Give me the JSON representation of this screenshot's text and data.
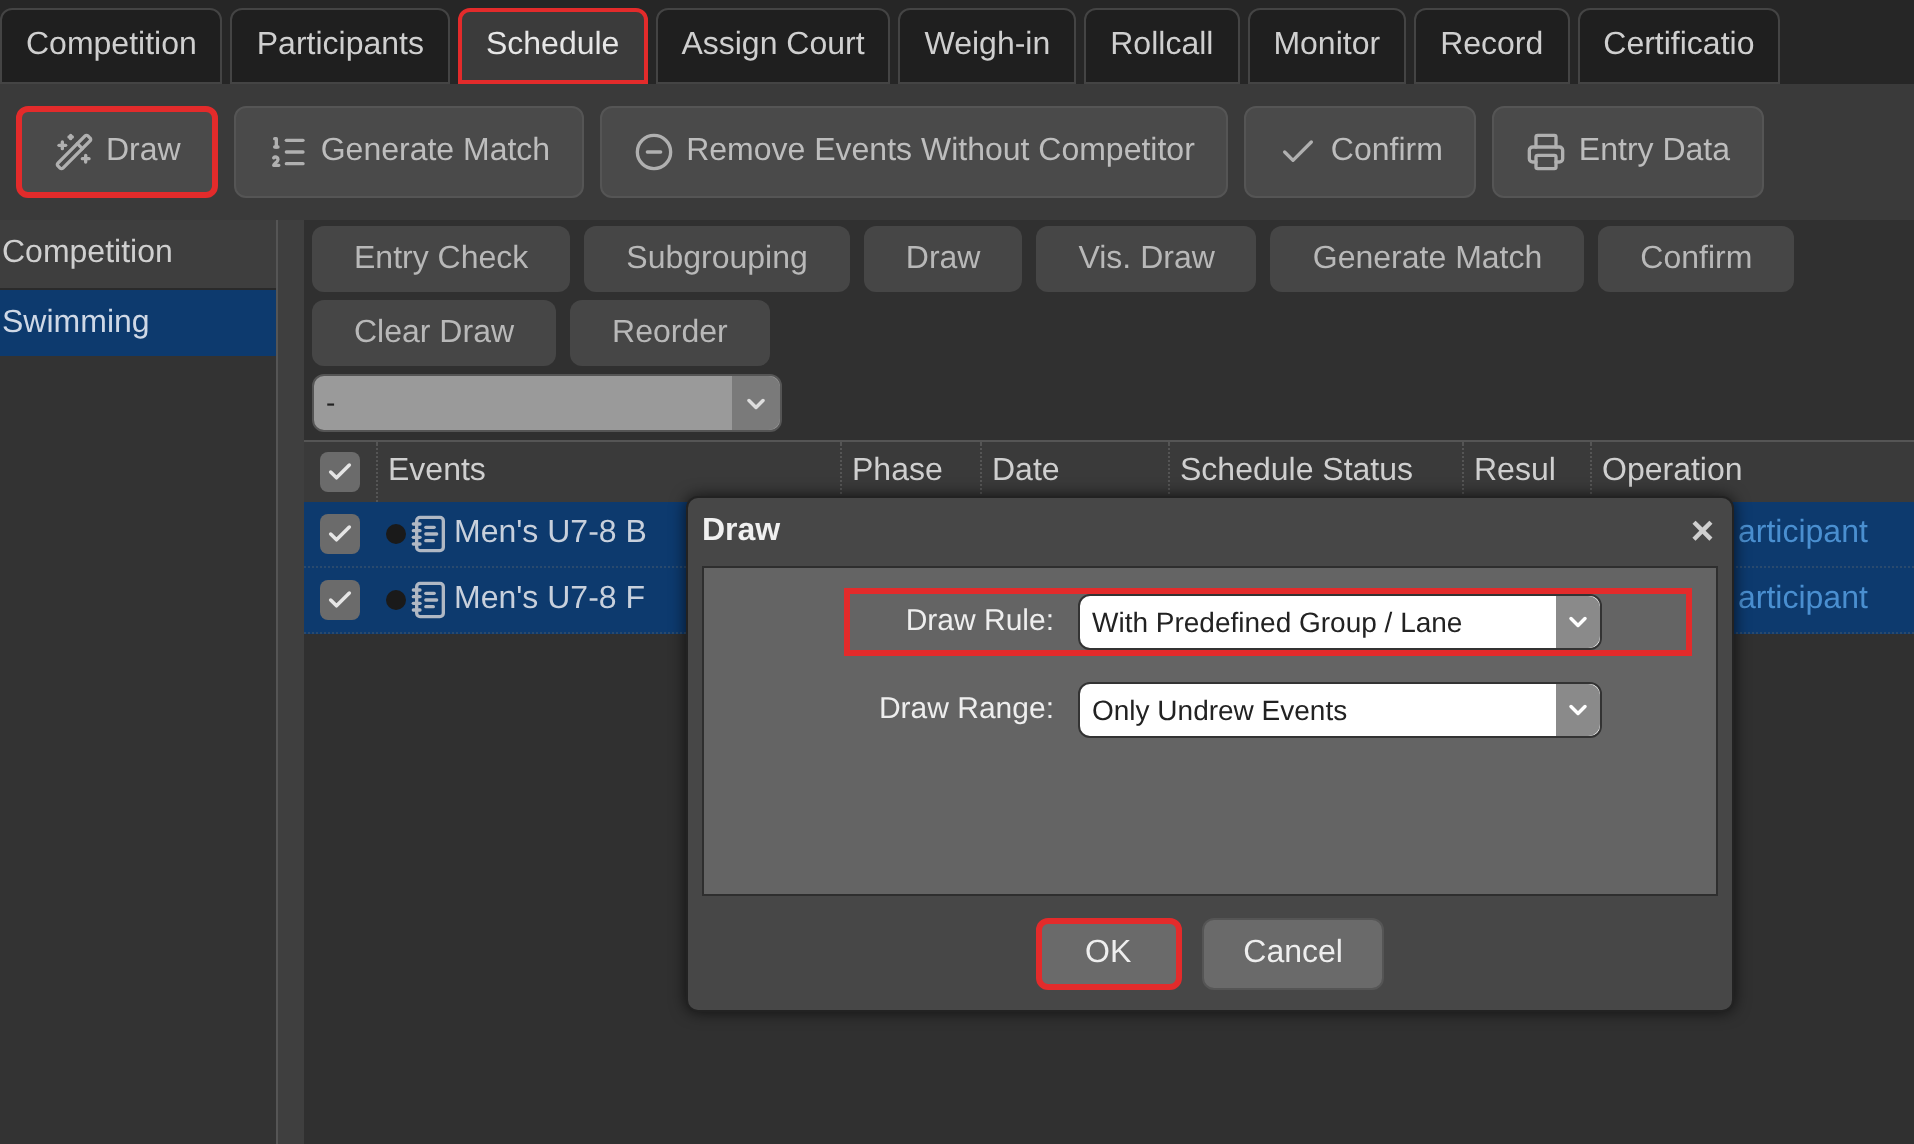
{
  "tabs": [
    {
      "label": "Competition",
      "selected": false
    },
    {
      "label": "Participants",
      "selected": false
    },
    {
      "label": "Schedule",
      "selected": true
    },
    {
      "label": "Assign Court",
      "selected": false
    },
    {
      "label": "Weigh-in",
      "selected": false
    },
    {
      "label": "Rollcall",
      "selected": false
    },
    {
      "label": "Monitor",
      "selected": false
    },
    {
      "label": "Record",
      "selected": false
    },
    {
      "label": "Certificatio",
      "selected": false
    }
  ],
  "toolbar": [
    {
      "label": "Draw",
      "highlighted": true
    },
    {
      "label": "Generate Match",
      "highlighted": false
    },
    {
      "label": "Remove Events Without Competitor",
      "highlighted": false
    },
    {
      "label": "Confirm",
      "highlighted": false
    },
    {
      "label": "Entry Data",
      "highlighted": false
    }
  ],
  "sidebar": {
    "header": "Competition",
    "items": [
      {
        "label": "Swimming",
        "selected": true
      }
    ]
  },
  "actions": [
    "Entry Check",
    "Subgrouping",
    "Draw",
    "Vis. Draw",
    "Generate Match",
    "Confirm",
    "Clear Draw",
    "Reorder"
  ],
  "filter": {
    "value": "-"
  },
  "table": {
    "all_checked": true,
    "columns": [
      "Events",
      "Phase",
      "Date",
      "Schedule Status",
      "Resul",
      "Operation"
    ],
    "rows": [
      {
        "checked": true,
        "selected": true,
        "event": "Men's U7-8 B",
        "operation": "articipant"
      },
      {
        "checked": true,
        "selected": true,
        "event": "Men's U7-8 F",
        "operation": "articipant"
      }
    ]
  },
  "dialog": {
    "title": "Draw",
    "close": "×",
    "fields": [
      {
        "label": "Draw Rule:",
        "value": "With Predefined Group / Lane",
        "highlighted": true
      },
      {
        "label": "Draw Range:",
        "value": "Only Undrew Events",
        "highlighted": false
      }
    ],
    "buttons": [
      {
        "label": "OK",
        "highlighted": true
      },
      {
        "label": "Cancel",
        "highlighted": false
      }
    ]
  }
}
